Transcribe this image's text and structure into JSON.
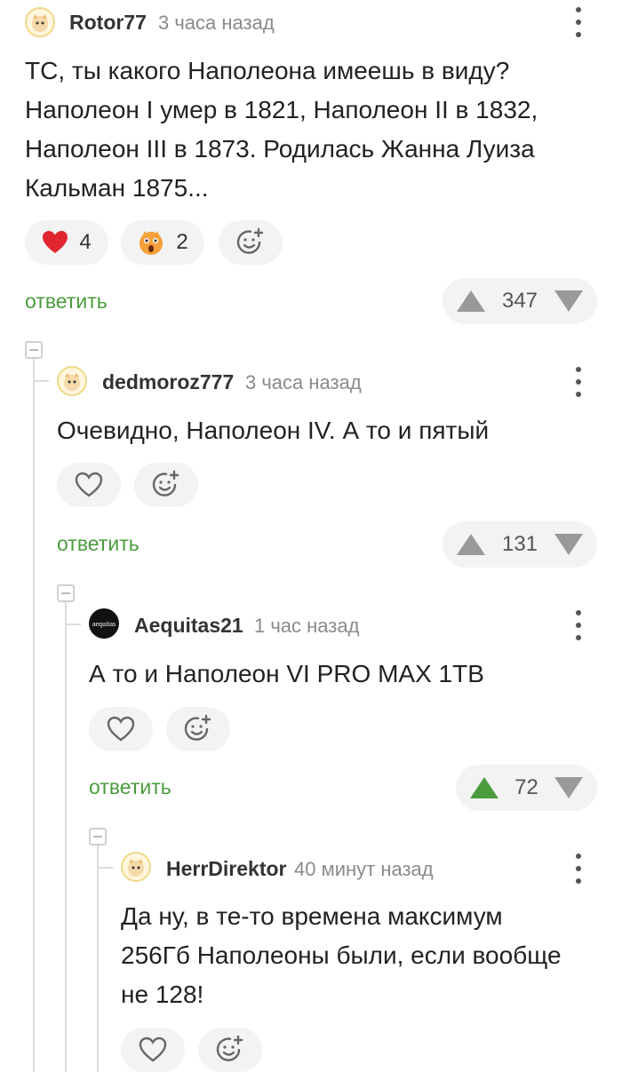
{
  "comments": [
    {
      "username": "Rotor77",
      "time": "3 часа назад",
      "text": "ТС, ты какого Наполеона имеешь в виду?\nНаполеон I умер в 1821, Наполеон II в 1832,\nНаполеон III в 1873. Родилась Жанна Луиза\nКальман 1875...",
      "reactions": [
        {
          "icon": "heart-icon",
          "count": "4"
        },
        {
          "icon": "shocked-face-icon",
          "count": "2"
        }
      ],
      "reply_label": "ответить",
      "rating": "347",
      "upvoted": false
    },
    {
      "username": "dedmoroz777",
      "time": "3 часа назад",
      "text": "Очевидно, Наполеон IV. А то и пятый",
      "reply_label": "ответить",
      "rating": "131",
      "upvoted": false
    },
    {
      "username": "Aequitas21",
      "avatar_text": "aequitas",
      "time": "1 час назад",
      "text": "А то и Наполеон VI PRO MAX 1TB",
      "reply_label": "ответить",
      "rating": "72",
      "upvoted": true
    },
    {
      "username": "HerrDirektor",
      "time": "40 минут назад",
      "text": "Да ну, в те-то времена максимум\n256Гб Наполеоны были, если вообще\nне 128!"
    }
  ],
  "colors": {
    "reply_green": "#4a9c3d",
    "heart_red": "#e0262f",
    "vote_grey": "#999999",
    "pill_bg": "#f3f3f3"
  }
}
